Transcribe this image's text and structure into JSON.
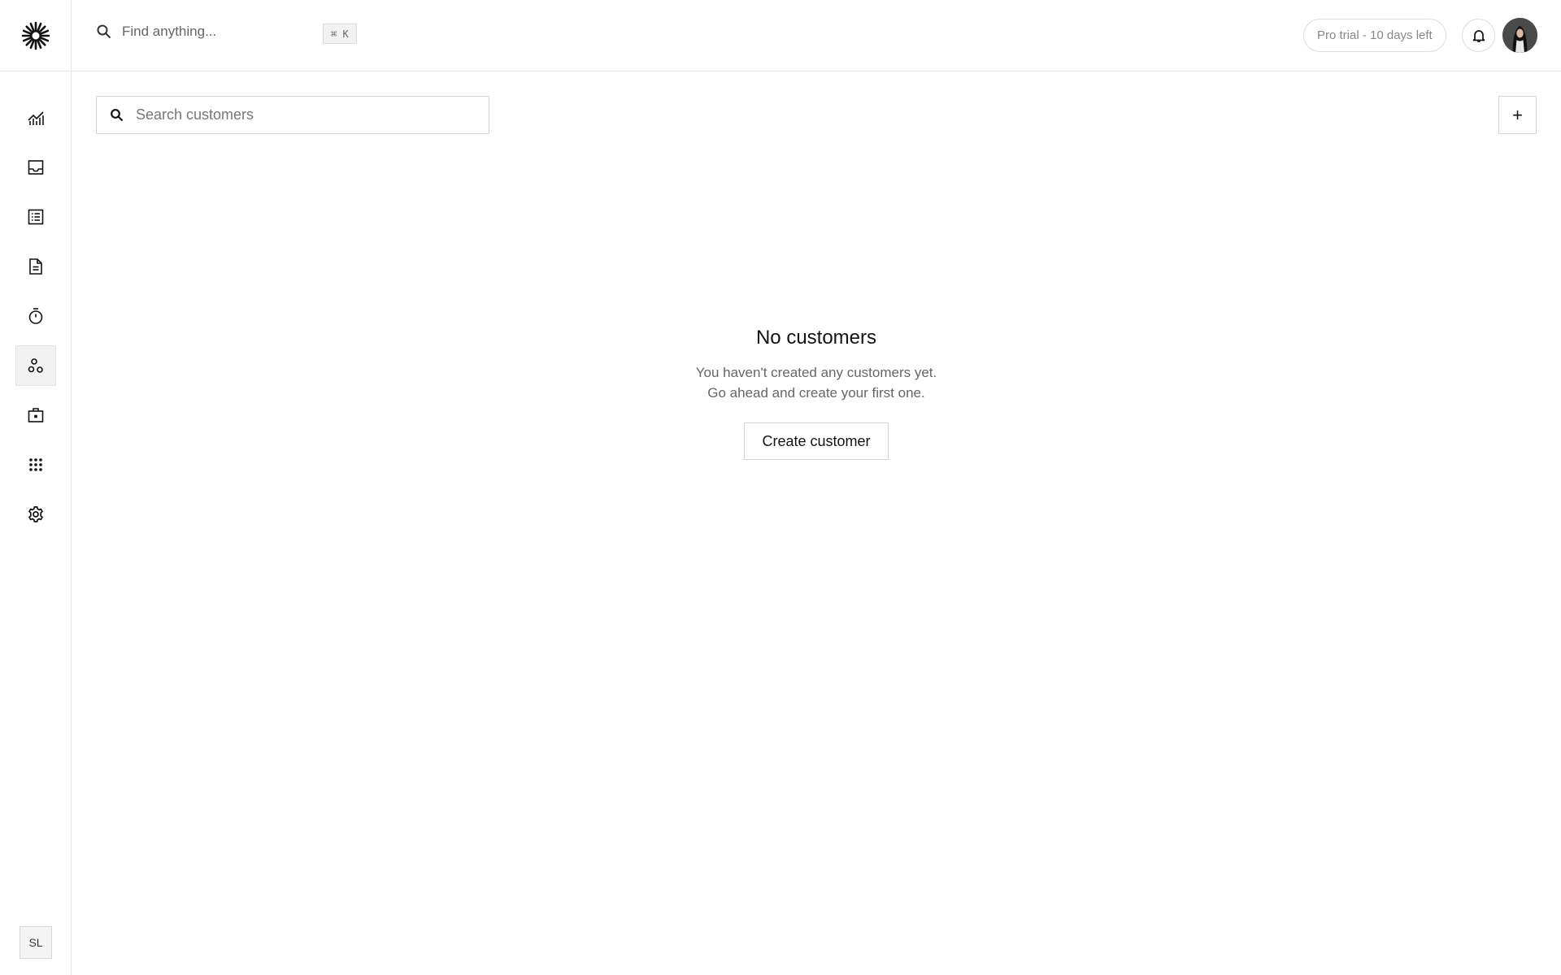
{
  "header": {
    "find_placeholder": "Find anything...",
    "shortcut": "⌘ K",
    "trial_badge": "Pro trial - 10 days left"
  },
  "sidebar": {
    "items": [
      {
        "icon": "chart-line-icon"
      },
      {
        "icon": "inbox-icon"
      },
      {
        "icon": "list-icon"
      },
      {
        "icon": "document-icon"
      },
      {
        "icon": "timer-icon"
      },
      {
        "icon": "customers-icon",
        "active": true
      },
      {
        "icon": "briefcase-icon"
      },
      {
        "icon": "apps-grid-icon"
      },
      {
        "icon": "gear-icon"
      }
    ],
    "user_initials": "SL"
  },
  "toolbar": {
    "search_placeholder": "Search customers",
    "add_label": "+"
  },
  "empty_state": {
    "title": "No customers",
    "line1": "You haven't created any customers yet.",
    "line2": "Go ahead and create your first one.",
    "button": "Create customer"
  },
  "colors": {
    "border": "#e5e5e5",
    "text": "#121212",
    "muted": "#666666",
    "active_nav_bg": "#f2f2f2"
  }
}
